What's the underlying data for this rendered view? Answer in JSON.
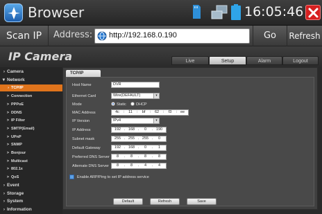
{
  "window": {
    "title": "Browser",
    "clock": "16:05:46"
  },
  "address_bar": {
    "scan_label": "Scan IP",
    "address_label": "Address:",
    "url": "http://192.168.0.190",
    "go_label": "Go",
    "refresh_label": "Refresh"
  },
  "web": {
    "brand": "IP Camera",
    "tabs": [
      {
        "label": "Live",
        "active": false
      },
      {
        "label": "Setup",
        "active": true
      },
      {
        "label": "Alarm",
        "active": false
      },
      {
        "label": "Logout",
        "active": false
      }
    ],
    "sidebar": [
      {
        "label": "Camera",
        "kind": "cat",
        "prefix": "›"
      },
      {
        "label": "Network",
        "kind": "cat",
        "prefix": "▾"
      },
      {
        "label": "TCP/IP",
        "kind": "sub",
        "prefix": "›",
        "selected": true
      },
      {
        "label": "Connection",
        "kind": "sub",
        "prefix": ">"
      },
      {
        "label": "PPPoE",
        "kind": "sub",
        "prefix": ">"
      },
      {
        "label": "DDNS",
        "kind": "sub",
        "prefix": ">"
      },
      {
        "label": "IP Filter",
        "kind": "sub",
        "prefix": ">"
      },
      {
        "label": "SMTP(Email)",
        "kind": "sub",
        "prefix": ">"
      },
      {
        "label": "UPnP",
        "kind": "sub",
        "prefix": ">"
      },
      {
        "label": "SNMP",
        "kind": "sub",
        "prefix": ">"
      },
      {
        "label": "Bonjour",
        "kind": "sub",
        "prefix": ">"
      },
      {
        "label": "Multicast",
        "kind": "sub",
        "prefix": ">"
      },
      {
        "label": "802.1x",
        "kind": "sub",
        "prefix": ">"
      },
      {
        "label": "QoS",
        "kind": "sub",
        "prefix": ">"
      },
      {
        "label": "Event",
        "kind": "cat",
        "prefix": "›"
      },
      {
        "label": "Storage",
        "kind": "cat",
        "prefix": "›"
      },
      {
        "label": "System",
        "kind": "cat",
        "prefix": "›"
      },
      {
        "label": "Information",
        "kind": "cat",
        "prefix": "›"
      }
    ],
    "content_tab": "TCP/IP",
    "help": "?",
    "form": {
      "host_name": {
        "label": "Host Name",
        "value": "DVR"
      },
      "ethernet_card": {
        "label": "Ethernet Card",
        "value": "Wire(DEFAULT)"
      },
      "mode": {
        "label": "Mode",
        "options": [
          "Static",
          "DHCP"
        ],
        "selected": "Static"
      },
      "mac": {
        "label": "MAC Address",
        "parts": [
          "4c",
          "11",
          "bf",
          "62",
          "f3",
          "ee"
        ]
      },
      "ip_version": {
        "label": "IP Version",
        "value": "IPv4"
      },
      "ip_address": {
        "label": "IP Address",
        "parts": [
          "192",
          "168",
          "0",
          "190"
        ]
      },
      "subnet": {
        "label": "Subnet mask",
        "parts": [
          "255",
          "255",
          "255",
          "0"
        ]
      },
      "gateway": {
        "label": "Default Gateway",
        "parts": [
          "192",
          "168",
          "0",
          "1"
        ]
      },
      "dns1": {
        "label": "Preferred DNS Server",
        "parts": [
          "8",
          "8",
          "8",
          "8"
        ]
      },
      "dns2": {
        "label": "Alternate DNS Server",
        "parts": [
          "8",
          "8",
          "4",
          "4"
        ]
      },
      "arp": {
        "label": "Enable ARP/Ping to set IP address service",
        "checked": true
      }
    },
    "buttons": {
      "default": "Default",
      "refresh": "Refresh",
      "save": "Save"
    }
  }
}
